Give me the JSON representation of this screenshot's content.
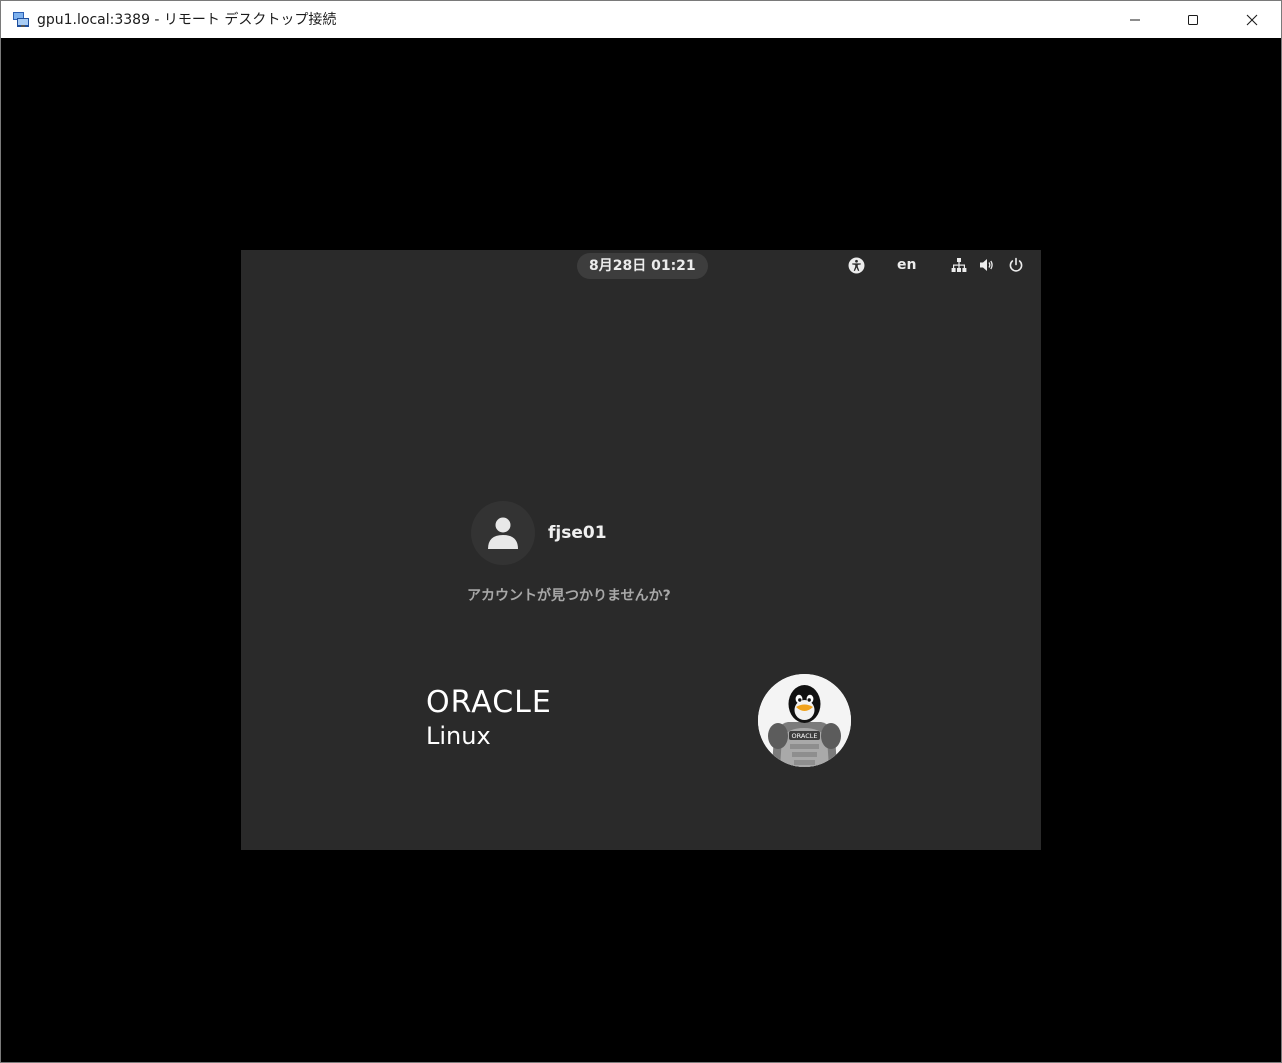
{
  "window": {
    "title": "gpu1.local:3389 - リモート デスクトップ接続",
    "app_icon": "remote-desktop-icon",
    "controls": [
      "minimize-icon",
      "maximize-icon",
      "close-icon"
    ]
  },
  "top_panel": {
    "clock": "8月28日  01:21",
    "language": "en",
    "icons": [
      "accessibility-icon",
      "network-icon",
      "volume-icon",
      "power-icon"
    ]
  },
  "login": {
    "username": "fjse01",
    "avatar_icon": "user-icon",
    "not_listed_label": "アカウントが見つかりませんか?"
  },
  "branding": {
    "logo_text": "ORACLE",
    "logo_subtext": "Linux",
    "mascot_badge_text": "ORACLE"
  },
  "colors": {
    "screen_bg": "#2a2a2a",
    "outer_bg": "#000000",
    "clock_pill": "#3d3d3d",
    "text_light": "#ececec",
    "text_muted": "#a8a8a8"
  }
}
